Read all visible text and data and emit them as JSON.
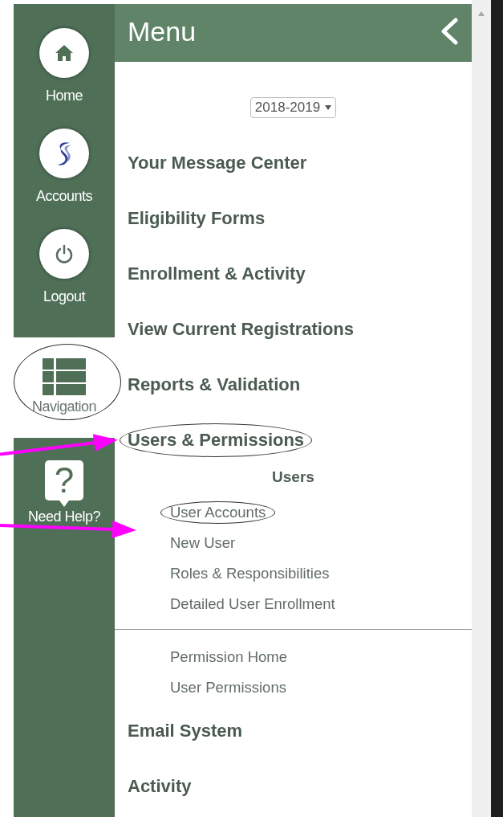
{
  "rail": {
    "items": [
      {
        "label": "Home",
        "kind": "home",
        "selected": false,
        "circled": false,
        "pointed": false
      },
      {
        "label": "Accounts",
        "kind": "logo",
        "selected": false,
        "circled": false,
        "pointed": false
      },
      {
        "label": "Logout",
        "kind": "power",
        "selected": false,
        "circled": false,
        "pointed": false
      },
      {
        "label": "Navigation",
        "kind": "list",
        "selected": true,
        "circled": true,
        "pointed": false
      },
      {
        "label": "Need Help?",
        "kind": "help",
        "glyph": "?",
        "selected": false,
        "circled": false,
        "pointed": false
      }
    ]
  },
  "menu": {
    "title": "Menu",
    "year_select": {
      "value": "2018-2019"
    },
    "items": [
      {
        "label": "Your Message Center",
        "circled": false,
        "pointed": false
      },
      {
        "label": "Eligibility Forms",
        "circled": false,
        "pointed": false
      },
      {
        "label": "Enrollment & Activity",
        "circled": false,
        "pointed": false
      },
      {
        "label": "View Current Registrations",
        "circled": false,
        "pointed": false
      },
      {
        "label": "Reports & Validation",
        "circled": false,
        "pointed": false
      },
      {
        "label": "Users & Permissions",
        "circled": true,
        "pointed": true,
        "groups": [
          {
            "heading": "Users",
            "items": [
              {
                "label": "User Accounts",
                "circled": true,
                "pointed": true
              },
              {
                "label": "New User",
                "circled": false,
                "pointed": false
              },
              {
                "label": "Roles & Responsibilities",
                "circled": false,
                "pointed": false
              },
              {
                "label": "Detailed User Enrollment",
                "circled": false,
                "pointed": false
              }
            ]
          },
          {
            "items": [
              {
                "label": "Permission Home",
                "circled": false,
                "pointed": false
              },
              {
                "label": "User Permissions",
                "circled": false,
                "pointed": false
              }
            ]
          }
        ]
      },
      {
        "label": "Email System",
        "circled": false,
        "pointed": false
      },
      {
        "label": "Activity",
        "circled": false,
        "pointed": false
      }
    ]
  }
}
